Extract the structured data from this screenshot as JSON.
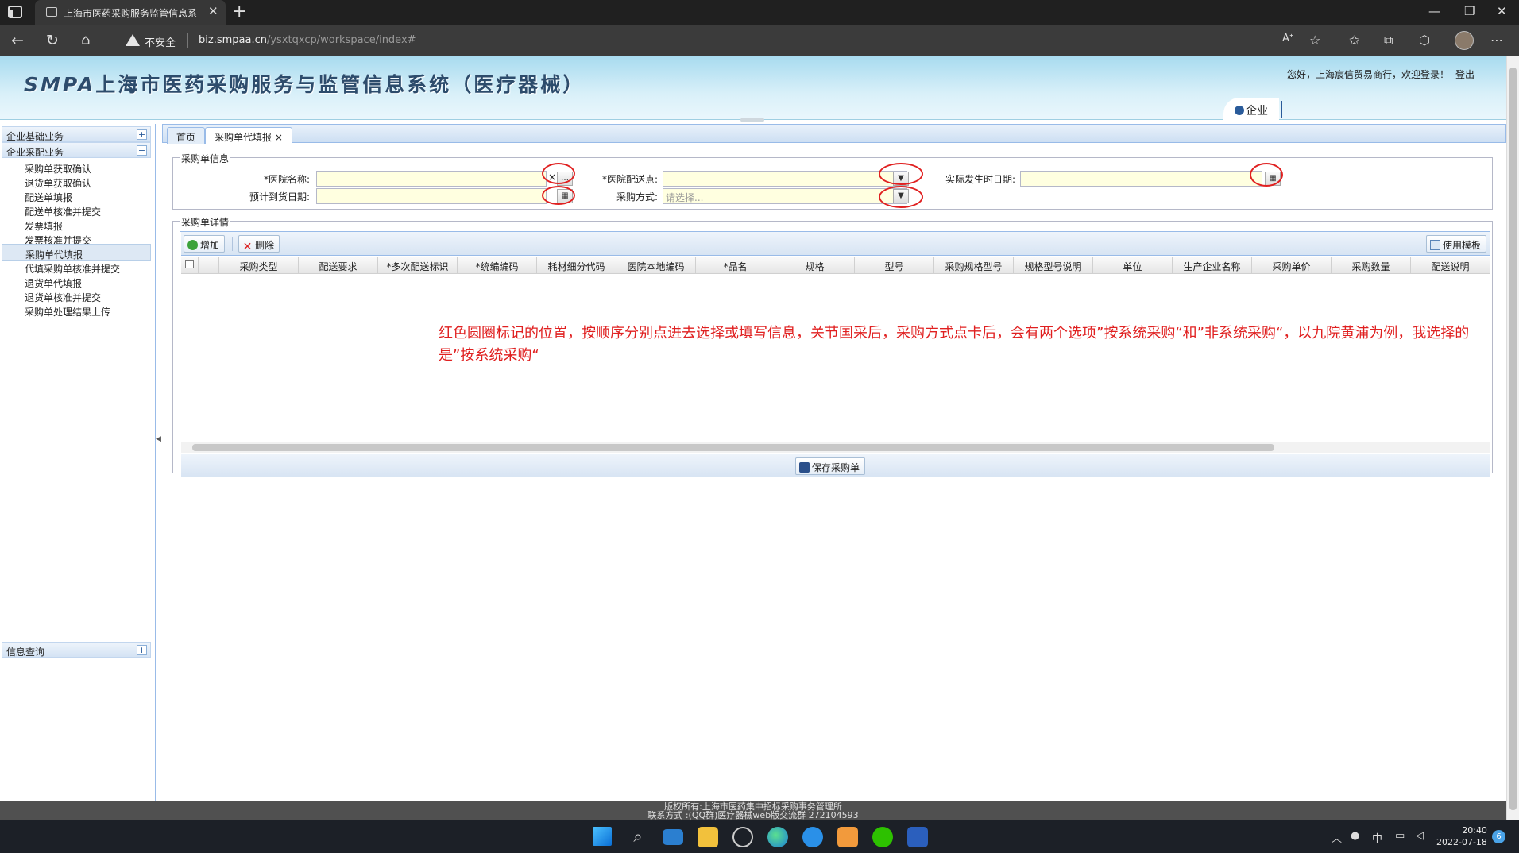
{
  "browser": {
    "tab_title": "上海市医药采购服务监管信息系",
    "insecure_label": "不安全",
    "url_host": "biz.smpaa.cn",
    "url_path": "/ysxtqxcp/workspace/index#"
  },
  "header": {
    "logo": "SMPA",
    "system_title": "上海市医药采购服务与监管信息系统（医疗器械）",
    "greeting": "您好，上海宸信贸易商行，欢迎登录！",
    "logout": "登出",
    "role": "企业"
  },
  "sidebar": {
    "sections": [
      {
        "label": "企业基础业务",
        "toggle": "+"
      },
      {
        "label": "企业采配业务",
        "toggle": "−"
      },
      {
        "label": "信息查询",
        "toggle": "+"
      }
    ],
    "items": [
      "采购单获取确认",
      "退货单获取确认",
      "配送单填报",
      "配送单核准并提交",
      "发票填报",
      "发票核准并提交",
      "采购单代填报",
      "代填采购单核准并提交",
      "退货单代填报",
      "退货单核准并提交",
      "采购单处理结果上传"
    ],
    "selected_item": "采购单代填报"
  },
  "tabs": [
    {
      "label": "首页"
    },
    {
      "label": "采购单代填报",
      "close": "×"
    }
  ],
  "form": {
    "legend": "采购单信息",
    "hospital_name_label": "*医院名称:",
    "hospital_delivery_label": "*医院配送点:",
    "actual_date_label": "实际发生时日期:",
    "expected_date_label": "预计到货日期:",
    "purchase_method_label": "采购方式:",
    "purchase_method_placeholder": "请选择...",
    "clear_icon": "×",
    "ellipsis": "…"
  },
  "detail": {
    "legend": "采购单详情",
    "add_button": "增加",
    "delete_button": "删除",
    "template_button": "使用模板",
    "save_button": "保存采购单",
    "columns": [
      "采购类型",
      "配送要求",
      "*多次配送标识",
      "*统编编码",
      "耗材细分代码",
      "医院本地编码",
      "*品名",
      "规格",
      "型号",
      "采购规格型号",
      "规格型号说明",
      "单位",
      "生产企业名称",
      "采购单价",
      "采购数量",
      "配送说明"
    ],
    "annotation": "红色圆圈标记的位置，按顺序分别点进去选择或填写信息，关节国采后，采购方式点卡后，会有两个选项”按系统采购“和”非系统采购“，以九院黄浦为例，我选择的是”按系统采购“"
  },
  "footer": {
    "line1": "版权所有:上海市医药集中招标采购事务管理所",
    "line2": "联系方式 :(QQ群)医疗器械web版交流群 272104593"
  },
  "taskbar": {
    "time": "20:40",
    "date": "2022-07-18",
    "ime": "中",
    "notifications": "6"
  },
  "colors": {
    "annotation_red": "#e02020",
    "banner_blue": "#a8dbef",
    "input_yellow": "#ffffe0",
    "ext_border": "#99bbe8"
  }
}
